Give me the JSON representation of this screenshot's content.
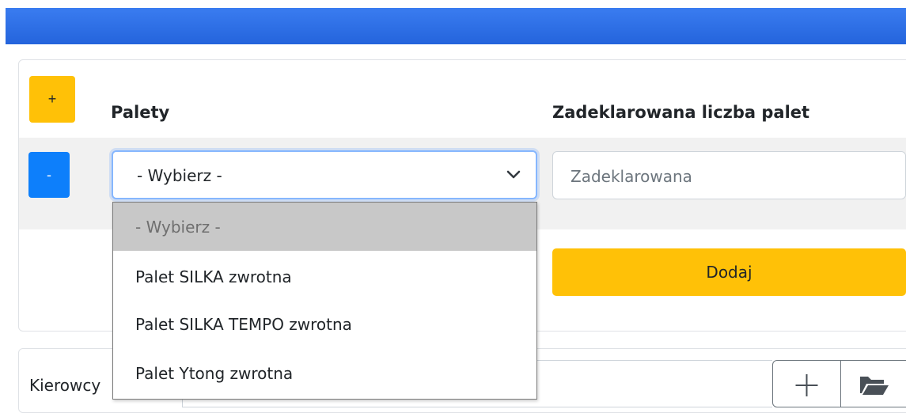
{
  "form": {
    "add_button_label": "+",
    "remove_button_label": "-",
    "col_pallets_header": "Palety",
    "col_declared_header": "Zadeklarowana liczba palet",
    "select_value": "- Wybierz -",
    "declared_placeholder": "Zadeklarowana",
    "submit_label": "Dodaj"
  },
  "dropdown": {
    "options": [
      {
        "label": "- Wybierz -",
        "selected": true
      },
      {
        "label": "Palet SILKA zwrotna",
        "selected": false
      },
      {
        "label": "Palet SILKA TEMPO zwrotna",
        "selected": false
      },
      {
        "label": "Palet Ytong zwrotna",
        "selected": false
      }
    ]
  },
  "drivers": {
    "label": "Kierowcy"
  },
  "colors": {
    "primary": "#0d7ffb",
    "warning": "#ffc107",
    "focus_border": "#86b7fe",
    "header_bar": "#2a6be2"
  },
  "icons": {
    "add_driver": "plus-icon",
    "browse": "folder-open-icon",
    "select_arrow": "chevron-down-icon"
  }
}
